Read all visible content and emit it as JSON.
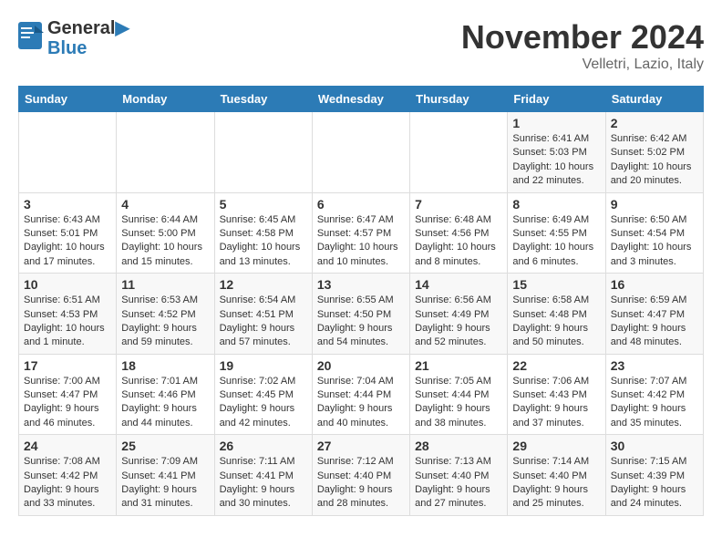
{
  "logo": {
    "line1": "General",
    "line2": "Blue"
  },
  "title": "November 2024",
  "location": "Velletri, Lazio, Italy",
  "days_header": [
    "Sunday",
    "Monday",
    "Tuesday",
    "Wednesday",
    "Thursday",
    "Friday",
    "Saturday"
  ],
  "weeks": [
    [
      {
        "day": "",
        "info": ""
      },
      {
        "day": "",
        "info": ""
      },
      {
        "day": "",
        "info": ""
      },
      {
        "day": "",
        "info": ""
      },
      {
        "day": "",
        "info": ""
      },
      {
        "day": "1",
        "info": "Sunrise: 6:41 AM\nSunset: 5:03 PM\nDaylight: 10 hours and 22 minutes."
      },
      {
        "day": "2",
        "info": "Sunrise: 6:42 AM\nSunset: 5:02 PM\nDaylight: 10 hours and 20 minutes."
      }
    ],
    [
      {
        "day": "3",
        "info": "Sunrise: 6:43 AM\nSunset: 5:01 PM\nDaylight: 10 hours and 17 minutes."
      },
      {
        "day": "4",
        "info": "Sunrise: 6:44 AM\nSunset: 5:00 PM\nDaylight: 10 hours and 15 minutes."
      },
      {
        "day": "5",
        "info": "Sunrise: 6:45 AM\nSunset: 4:58 PM\nDaylight: 10 hours and 13 minutes."
      },
      {
        "day": "6",
        "info": "Sunrise: 6:47 AM\nSunset: 4:57 PM\nDaylight: 10 hours and 10 minutes."
      },
      {
        "day": "7",
        "info": "Sunrise: 6:48 AM\nSunset: 4:56 PM\nDaylight: 10 hours and 8 minutes."
      },
      {
        "day": "8",
        "info": "Sunrise: 6:49 AM\nSunset: 4:55 PM\nDaylight: 10 hours and 6 minutes."
      },
      {
        "day": "9",
        "info": "Sunrise: 6:50 AM\nSunset: 4:54 PM\nDaylight: 10 hours and 3 minutes."
      }
    ],
    [
      {
        "day": "10",
        "info": "Sunrise: 6:51 AM\nSunset: 4:53 PM\nDaylight: 10 hours and 1 minute."
      },
      {
        "day": "11",
        "info": "Sunrise: 6:53 AM\nSunset: 4:52 PM\nDaylight: 9 hours and 59 minutes."
      },
      {
        "day": "12",
        "info": "Sunrise: 6:54 AM\nSunset: 4:51 PM\nDaylight: 9 hours and 57 minutes."
      },
      {
        "day": "13",
        "info": "Sunrise: 6:55 AM\nSunset: 4:50 PM\nDaylight: 9 hours and 54 minutes."
      },
      {
        "day": "14",
        "info": "Sunrise: 6:56 AM\nSunset: 4:49 PM\nDaylight: 9 hours and 52 minutes."
      },
      {
        "day": "15",
        "info": "Sunrise: 6:58 AM\nSunset: 4:48 PM\nDaylight: 9 hours and 50 minutes."
      },
      {
        "day": "16",
        "info": "Sunrise: 6:59 AM\nSunset: 4:47 PM\nDaylight: 9 hours and 48 minutes."
      }
    ],
    [
      {
        "day": "17",
        "info": "Sunrise: 7:00 AM\nSunset: 4:47 PM\nDaylight: 9 hours and 46 minutes."
      },
      {
        "day": "18",
        "info": "Sunrise: 7:01 AM\nSunset: 4:46 PM\nDaylight: 9 hours and 44 minutes."
      },
      {
        "day": "19",
        "info": "Sunrise: 7:02 AM\nSunset: 4:45 PM\nDaylight: 9 hours and 42 minutes."
      },
      {
        "day": "20",
        "info": "Sunrise: 7:04 AM\nSunset: 4:44 PM\nDaylight: 9 hours and 40 minutes."
      },
      {
        "day": "21",
        "info": "Sunrise: 7:05 AM\nSunset: 4:44 PM\nDaylight: 9 hours and 38 minutes."
      },
      {
        "day": "22",
        "info": "Sunrise: 7:06 AM\nSunset: 4:43 PM\nDaylight: 9 hours and 37 minutes."
      },
      {
        "day": "23",
        "info": "Sunrise: 7:07 AM\nSunset: 4:42 PM\nDaylight: 9 hours and 35 minutes."
      }
    ],
    [
      {
        "day": "24",
        "info": "Sunrise: 7:08 AM\nSunset: 4:42 PM\nDaylight: 9 hours and 33 minutes."
      },
      {
        "day": "25",
        "info": "Sunrise: 7:09 AM\nSunset: 4:41 PM\nDaylight: 9 hours and 31 minutes."
      },
      {
        "day": "26",
        "info": "Sunrise: 7:11 AM\nSunset: 4:41 PM\nDaylight: 9 hours and 30 minutes."
      },
      {
        "day": "27",
        "info": "Sunrise: 7:12 AM\nSunset: 4:40 PM\nDaylight: 9 hours and 28 minutes."
      },
      {
        "day": "28",
        "info": "Sunrise: 7:13 AM\nSunset: 4:40 PM\nDaylight: 9 hours and 27 minutes."
      },
      {
        "day": "29",
        "info": "Sunrise: 7:14 AM\nSunset: 4:40 PM\nDaylight: 9 hours and 25 minutes."
      },
      {
        "day": "30",
        "info": "Sunrise: 7:15 AM\nSunset: 4:39 PM\nDaylight: 9 hours and 24 minutes."
      }
    ]
  ]
}
